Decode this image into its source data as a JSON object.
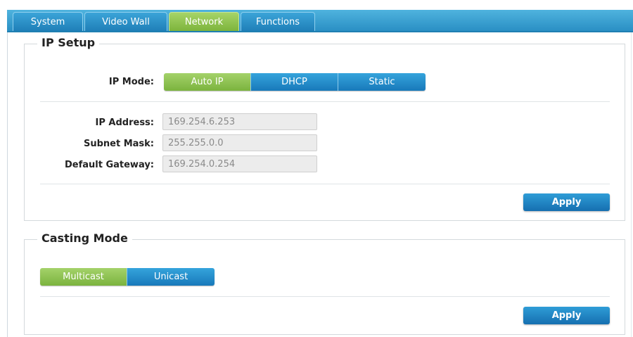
{
  "tabs": [
    {
      "label": "System"
    },
    {
      "label": "Video Wall"
    },
    {
      "label": "Network",
      "active": true
    },
    {
      "label": "Functions"
    }
  ],
  "ip_setup": {
    "title": "IP Setup",
    "mode_label": "IP Mode:",
    "modes": [
      {
        "label": "Auto IP",
        "active": true
      },
      {
        "label": "DHCP"
      },
      {
        "label": "Static"
      }
    ],
    "fields": {
      "ip_address": {
        "label": "IP Address:",
        "value": "169.254.6.253"
      },
      "subnet_mask": {
        "label": "Subnet Mask:",
        "value": "255.255.0.0"
      },
      "default_gateway": {
        "label": "Default Gateway:",
        "value": "169.254.0.254"
      }
    },
    "apply_label": "Apply"
  },
  "casting_mode": {
    "title": "Casting Mode",
    "modes": [
      {
        "label": "Multicast",
        "active": true
      },
      {
        "label": "Unicast"
      }
    ],
    "apply_label": "Apply"
  },
  "colors": {
    "accent_blue": "#1f7fb8",
    "active_green": "#7db43c"
  }
}
